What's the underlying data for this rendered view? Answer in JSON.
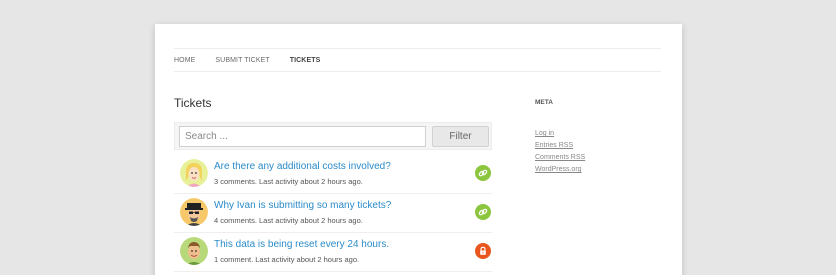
{
  "nav": {
    "items": [
      {
        "label": "HOME",
        "current": false
      },
      {
        "label": "SUBMIT TICKET",
        "current": false
      },
      {
        "label": "TICKETS",
        "current": true
      }
    ]
  },
  "main": {
    "title": "Tickets",
    "search": {
      "placeholder": "Search ...",
      "value": ""
    },
    "filter_label": "Filter",
    "tickets": [
      {
        "title": "Are there any additional costs involved?",
        "meta": "3 comments. Last activity about 2 hours ago.",
        "status_icon": "link-icon",
        "status_color": "#8cc63f"
      },
      {
        "title": "Why Ivan is submitting so many tickets?",
        "meta": "4 comments. Last activity about 2 hours ago.",
        "status_icon": "link-icon",
        "status_color": "#8cc63f"
      },
      {
        "title": "This data is being reset every 24 hours.",
        "meta": "1 comment. Last activity about 2 hours ago.",
        "status_icon": "lock-icon",
        "status_color": "#e8561e"
      }
    ]
  },
  "sidebar": {
    "title": "META",
    "links": [
      "Log in",
      "Entries RSS",
      "Comments RSS",
      "WordPress.org"
    ]
  },
  "colors": {
    "link": "#2a8bc9",
    "page_background": "#e6e6e6"
  }
}
